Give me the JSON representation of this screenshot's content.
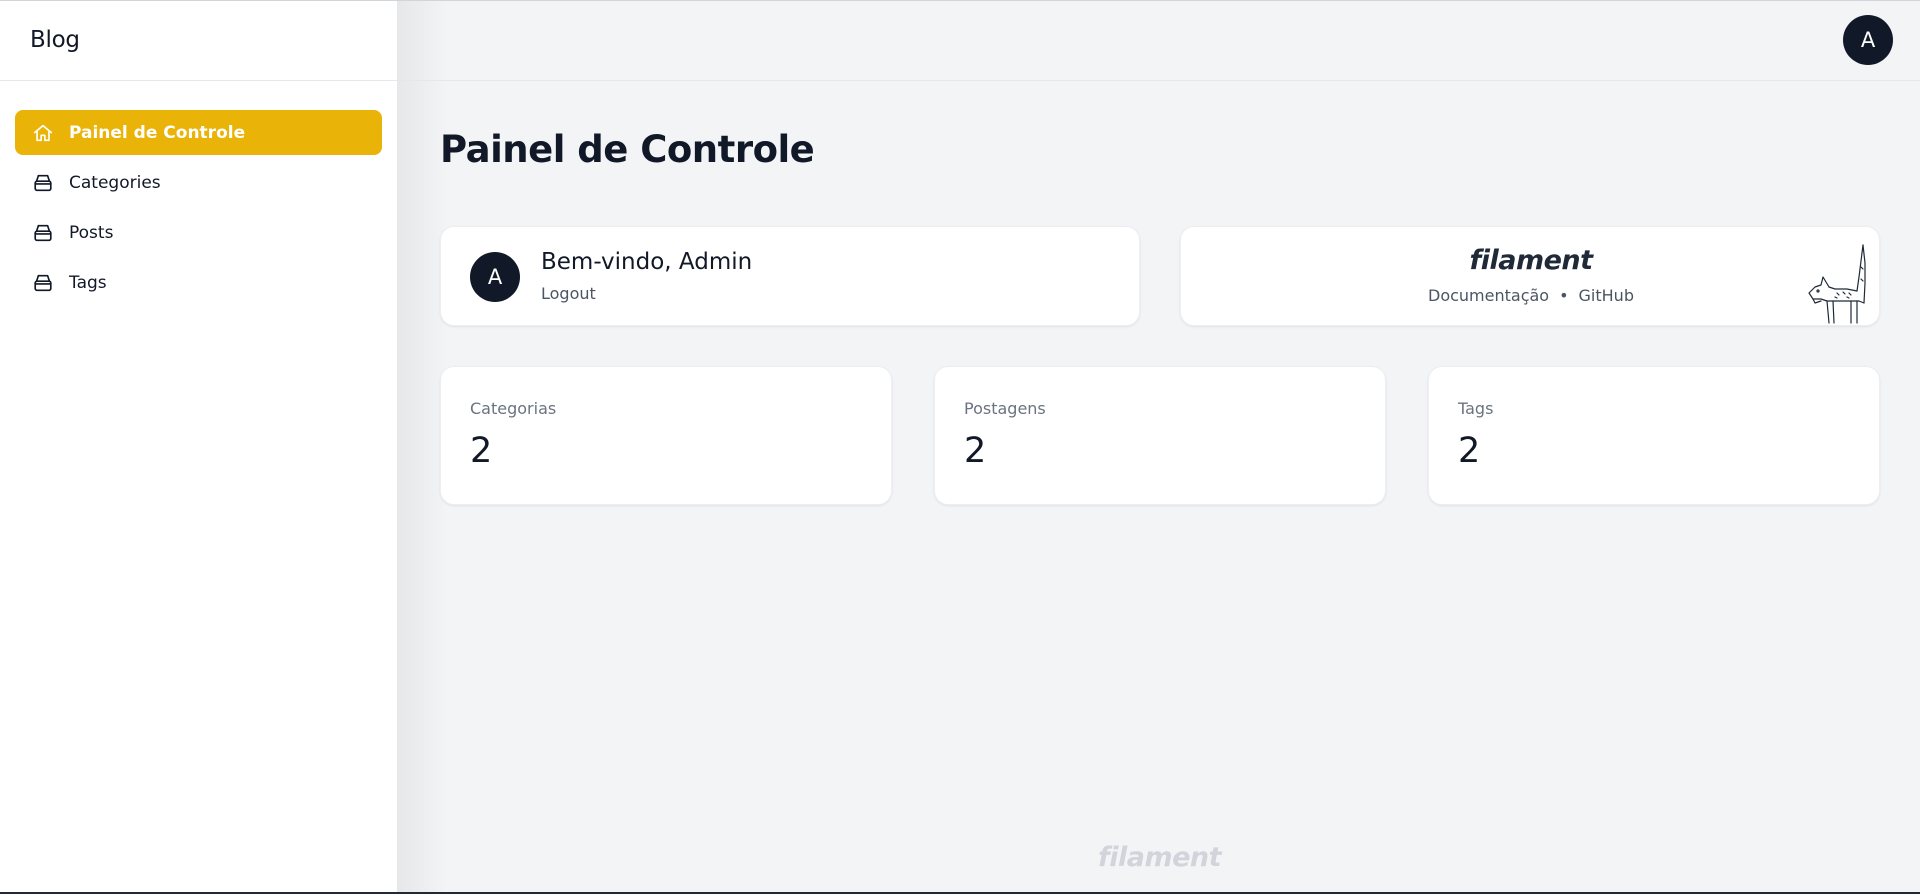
{
  "sidebar": {
    "brand": "Blog",
    "items": [
      {
        "label": "Painel de Controle",
        "icon": "home-icon",
        "active": true
      },
      {
        "label": "Categories",
        "icon": "archive-icon",
        "active": false
      },
      {
        "label": "Posts",
        "icon": "archive-icon",
        "active": false
      },
      {
        "label": "Tags",
        "icon": "archive-icon",
        "active": false
      }
    ]
  },
  "topbar": {
    "user_initial": "A"
  },
  "page": {
    "title": "Painel de Controle"
  },
  "welcome": {
    "initial": "A",
    "title": "Bem-vindo, Admin",
    "logout": "Logout"
  },
  "filament": {
    "logo": "filament",
    "docs": "Documentação",
    "separator": "•",
    "github": "GitHub"
  },
  "stats": [
    {
      "label": "Categorias",
      "value": "2"
    },
    {
      "label": "Postagens",
      "value": "2"
    },
    {
      "label": "Tags",
      "value": "2"
    }
  ],
  "footer": {
    "logo": "filament"
  },
  "colors": {
    "accent": "#eab308",
    "dark": "#111827",
    "background": "#f3f4f6"
  }
}
